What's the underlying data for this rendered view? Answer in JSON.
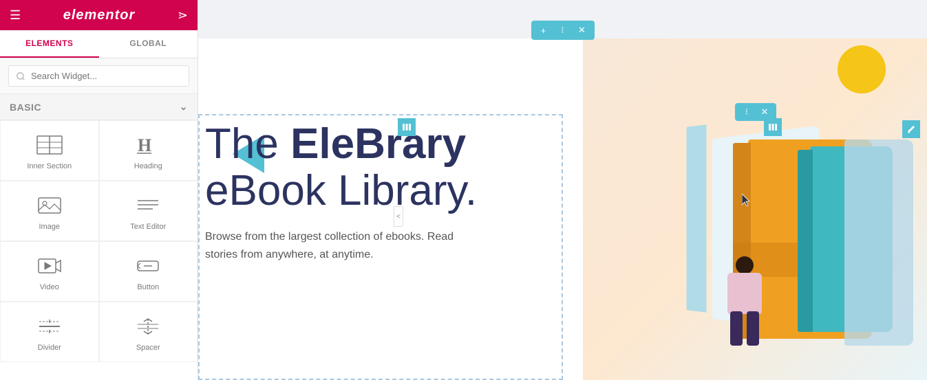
{
  "topbar": {
    "logo_text": "elementor",
    "hamburger_label": "menu",
    "grid_label": "apps"
  },
  "panel": {
    "tabs": [
      {
        "id": "elements",
        "label": "ELEMENTS",
        "active": true
      },
      {
        "id": "global",
        "label": "GLOBAL",
        "active": false
      }
    ],
    "search_placeholder": "Search Widget...",
    "basic_section_label": "BASIC",
    "widgets": [
      {
        "id": "inner-section",
        "label": "Inner Section",
        "icon": "inner-section-icon"
      },
      {
        "id": "heading",
        "label": "Heading",
        "icon": "heading-icon"
      },
      {
        "id": "image",
        "label": "Image",
        "icon": "image-icon"
      },
      {
        "id": "text-editor",
        "label": "Text Editor",
        "icon": "text-editor-icon"
      },
      {
        "id": "video",
        "label": "Video",
        "icon": "video-icon"
      },
      {
        "id": "button",
        "label": "Button",
        "icon": "button-icon"
      },
      {
        "id": "divider",
        "label": "Divider",
        "icon": "divider-icon"
      },
      {
        "id": "spacer",
        "label": "Spacer",
        "icon": "spacer-icon"
      }
    ]
  },
  "canvas": {
    "section_toolbar": {
      "add_btn": "+",
      "move_btn": "⠿",
      "close_btn": "×"
    },
    "inner_toolbar": {
      "move_btn": "⠿",
      "close_btn": "×"
    },
    "heading_line1": "The ",
    "heading_brand": "EleBrary",
    "heading_line2": "eBook Library.",
    "subtext": "Browse from the largest collection of ebooks. Read stories from anywhere, at anytime."
  }
}
